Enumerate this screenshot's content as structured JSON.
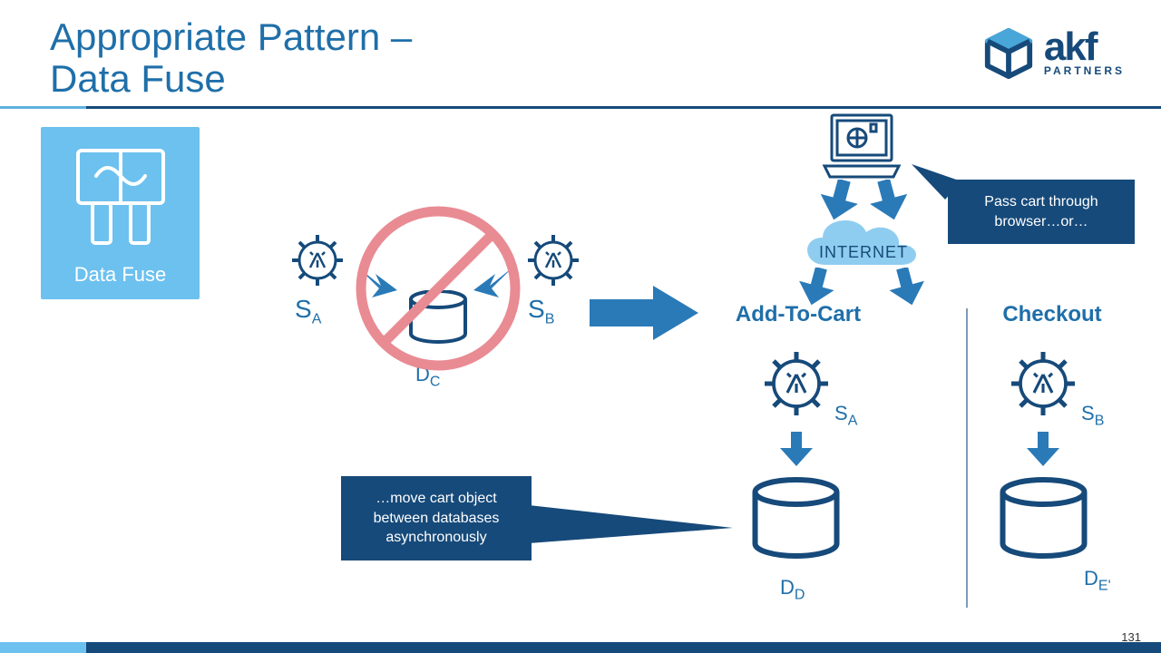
{
  "title": {
    "line1": "Appropriate Pattern –",
    "line2": "Data Fuse"
  },
  "logo": {
    "name": "akf",
    "sub": "PARTNERS"
  },
  "badge": {
    "label": "Data Fuse"
  },
  "left_diagram": {
    "service_a": "S",
    "service_a_sub": "A",
    "service_b": "S",
    "service_b_sub": "B",
    "db_label": "D",
    "db_sub": "C"
  },
  "right_diagram": {
    "internet": "INTERNET",
    "col_a_title": "Add-To-Cart",
    "col_b_title": "Checkout",
    "svc_a_label": "S",
    "svc_a_sub": "A",
    "svc_b_label": "S",
    "svc_b_sub": "B",
    "db_d_label": "D",
    "db_d_sub": "D",
    "db_e_label": "D",
    "db_e_sub": "E'"
  },
  "callouts": {
    "browser": "Pass cart through browser…or…",
    "async": "…move cart object between databases asynchronously"
  },
  "page_number": "131"
}
